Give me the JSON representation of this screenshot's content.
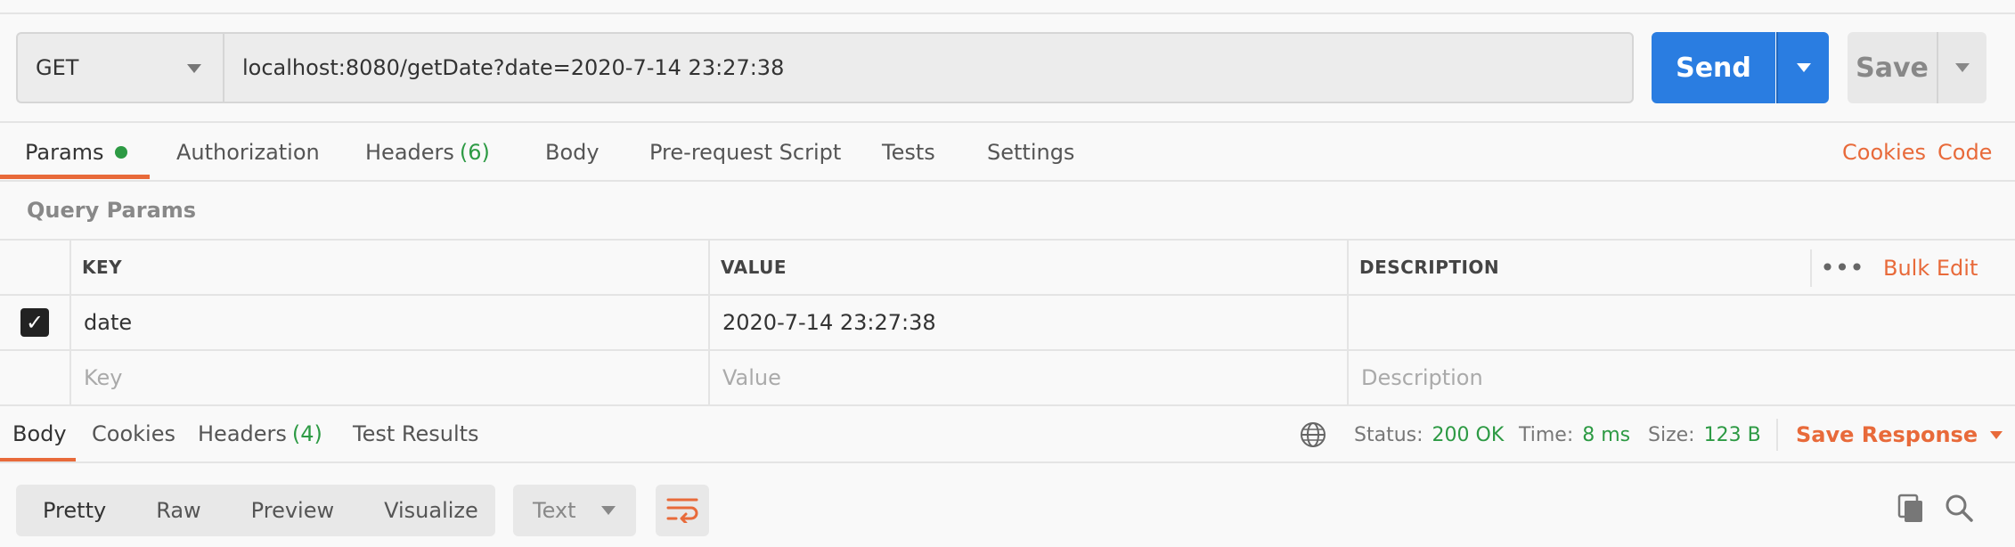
{
  "request": {
    "method": "GET",
    "url": "localhost:8080/getDate?date=2020-7-14 23:27:38",
    "send_label": "Send",
    "save_label": "Save"
  },
  "request_tabs": {
    "params": "Params",
    "authorization": "Authorization",
    "headers": "Headers",
    "headers_count": "(6)",
    "body": "Body",
    "pre_request": "Pre-request Script",
    "tests": "Tests",
    "settings": "Settings",
    "cookies": "Cookies",
    "code": "Code"
  },
  "query_params": {
    "title": "Query Params",
    "columns": {
      "key": "KEY",
      "value": "VALUE",
      "description": "DESCRIPTION"
    },
    "bulk_edit": "Bulk Edit",
    "rows": [
      {
        "checked": true,
        "key": "date",
        "value": "2020-7-14 23:27:38",
        "description": ""
      }
    ],
    "placeholder": {
      "key": "Key",
      "value": "Value",
      "description": "Description"
    }
  },
  "response_tabs": {
    "body": "Body",
    "cookies": "Cookies",
    "headers": "Headers",
    "headers_count": "(4)",
    "test_results": "Test Results"
  },
  "response_status": {
    "status_label": "Status:",
    "status_value": "200 OK",
    "time_label": "Time:",
    "time_value": "8 ms",
    "size_label": "Size:",
    "size_value": "123 B",
    "save_response": "Save Response"
  },
  "body_toolbar": {
    "modes": [
      "Pretty",
      "Raw",
      "Preview",
      "Visualize"
    ],
    "active_mode": "Pretty",
    "format": "Text"
  },
  "icons": {
    "globe": "globe-icon",
    "wrap": "wrap-lines-icon",
    "copy": "copy-icon",
    "search": "search-icon",
    "more": "more-icon"
  },
  "colors": {
    "accent": "#e86a3a",
    "send": "#2a7de1",
    "success": "#2d9a44"
  }
}
